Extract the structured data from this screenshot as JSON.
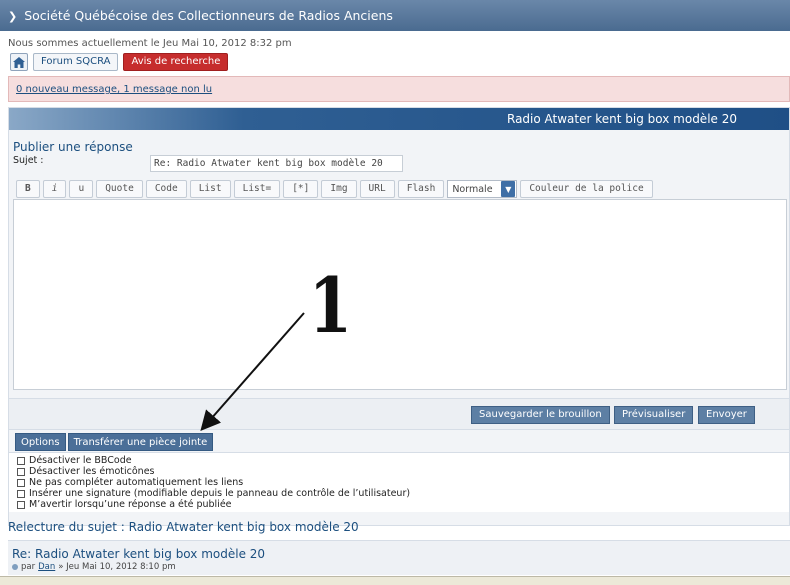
{
  "header": {
    "title": "Société Québécoise des Collectionneurs de Radios Anciens"
  },
  "dateline": "Nous sommes actuellement le Jeu Mai 10, 2012 8:32 pm",
  "nav": {
    "home_icon": "home-icon",
    "forum": "Forum SQCRA",
    "search_notice": "Avis de recherche"
  },
  "notice": {
    "text": "0 nouveau message, 1 message non lu"
  },
  "topic": {
    "title": "Radio Atwater kent big box modèle 20"
  },
  "reply": {
    "heading": "Publier une réponse",
    "subject_label": "Sujet :",
    "subject_value": "Re: Radio Atwater kent big box modèle 20"
  },
  "toolbar": {
    "buttons": [
      "B",
      "i",
      "u",
      "Quote",
      "Code",
      "List",
      "List=",
      "[*]",
      "Img",
      "URL",
      "Flash"
    ],
    "font_size_selected": "Normale",
    "font_color_label": "Couleur de la police"
  },
  "actions": {
    "save_draft": "Sauvegarder le brouillon",
    "preview": "Prévisualiser",
    "submit": "Envoyer"
  },
  "tabs": [
    "Options",
    "Transférer une pièce jointe"
  ],
  "options": [
    "Désactiver le BBCode",
    "Désactiver les émoticônes",
    "Ne pas compléter automatiquement les liens",
    "Insérer une signature (modifiable depuis le panneau de contrôle de l’utilisateur)",
    "M’avertir lorsqu’une réponse a été publiée"
  ],
  "review": {
    "heading": "Relecture du sujet : Radio Atwater kent big box modèle 20",
    "post_title": "Re: Radio Atwater kent big box modèle 20",
    "post_by": "par",
    "post_author": "Dan",
    "post_date": "» Jeu Mai 10, 2012 8:10 pm"
  },
  "annotation": {
    "number": "1"
  },
  "colors": {
    "header_blue": "#4a6b90",
    "accent_red": "#c62d2d",
    "button_blue": "#5d7fa4",
    "link_blue": "#1c4f7f"
  }
}
